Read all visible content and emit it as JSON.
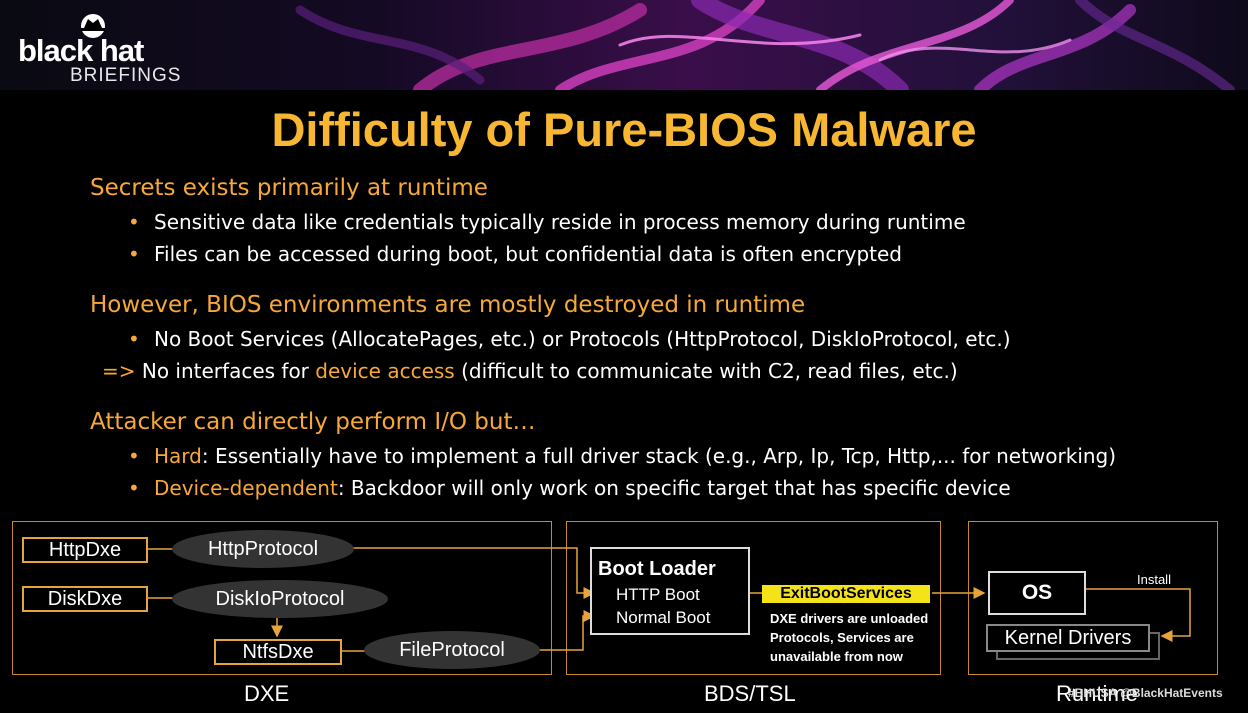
{
  "logo": {
    "line1": "black hat",
    "line2": "BRIEFINGS"
  },
  "title": "Difficulty of Pure-BIOS Malware",
  "sections": [
    {
      "heading": "Secrets exists primarily at runtime",
      "bullets": [
        "Sensitive data like credentials typically reside in process memory during runtime",
        "Files can be accessed during boot, but confidential data is often encrypted"
      ]
    },
    {
      "heading": "However, BIOS environments are mostly destroyed in runtime",
      "bullets": [
        "No Boot Services (AllocatePages, etc.) or Protocols (HttpProtocol, DiskIoProtocol, etc.)"
      ],
      "implication": {
        "arrow": "=>",
        "pre": "No interfaces for",
        "highlight": "device access",
        "post": "(difficult to communicate with C2, read files, etc.)"
      }
    },
    {
      "heading": "Attacker can directly perform I/O but…",
      "bullets_hl": [
        {
          "term": "Hard",
          "text": ": Essentially have to implement a full driver stack (e.g., Arp, Ip, Tcp, Http,... for networking)"
        },
        {
          "term": "Device-dependent",
          "text": ": Backdoor will only work on specific target that has specific device"
        }
      ]
    }
  ],
  "diagram": {
    "dxe": {
      "label": "DXE",
      "drivers": [
        "HttpDxe",
        "DiskDxe",
        "NtfsDxe"
      ],
      "protocols": [
        "HttpProtocol",
        "DiskIoProtocol",
        "FileProtocol"
      ]
    },
    "bds": {
      "label": "BDS/TSL",
      "loader_title": "Boot Loader",
      "items": [
        "HTTP Boot",
        "Normal Boot"
      ],
      "exit_call": "ExitBootServices",
      "note": [
        "DXE drivers are unloaded",
        "Protocols, Services are",
        "unavailable from now"
      ]
    },
    "runtime": {
      "label": "Runtime",
      "os": "OS",
      "kernel": "Kernel Drivers",
      "install": "Install"
    }
  },
  "footer": {
    "handle": "#BHUSA @BlackHatEvents"
  },
  "colors": {
    "title": "#f7b733",
    "accent": "#f7a838",
    "box_border": "#c8872a",
    "exit_bg": "#f5e31a"
  }
}
